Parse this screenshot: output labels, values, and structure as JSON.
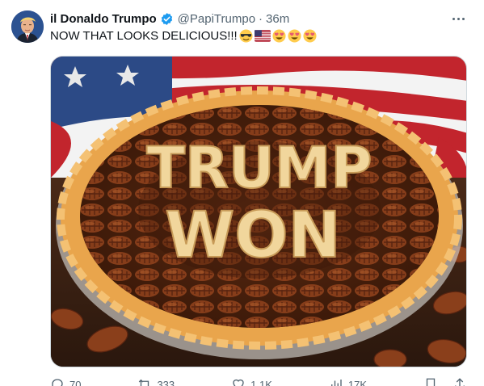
{
  "tweet": {
    "display_name": "il Donaldo Trumpo",
    "handle": "@PapiTrumpo",
    "separator": "·",
    "time": "36m",
    "text": "NOW THAT LOOKS DELICIOUS!!!",
    "emojis": [
      "smiling-face-with-sunglasses",
      "us-flag",
      "heart-eyes",
      "heart-eyes",
      "heart-eyes"
    ],
    "media": {
      "alt_visible_text_line1": "TRUMP",
      "alt_visible_text_line2": "WON"
    }
  },
  "actions": {
    "replies": "70",
    "reposts": "333",
    "likes": "1.1K",
    "views": "17K"
  },
  "colors": {
    "verified": "#1d9bf0",
    "secondary_text": "#536471",
    "pie_crust": "#e9a54c",
    "pecan": "#7a3a1c"
  }
}
